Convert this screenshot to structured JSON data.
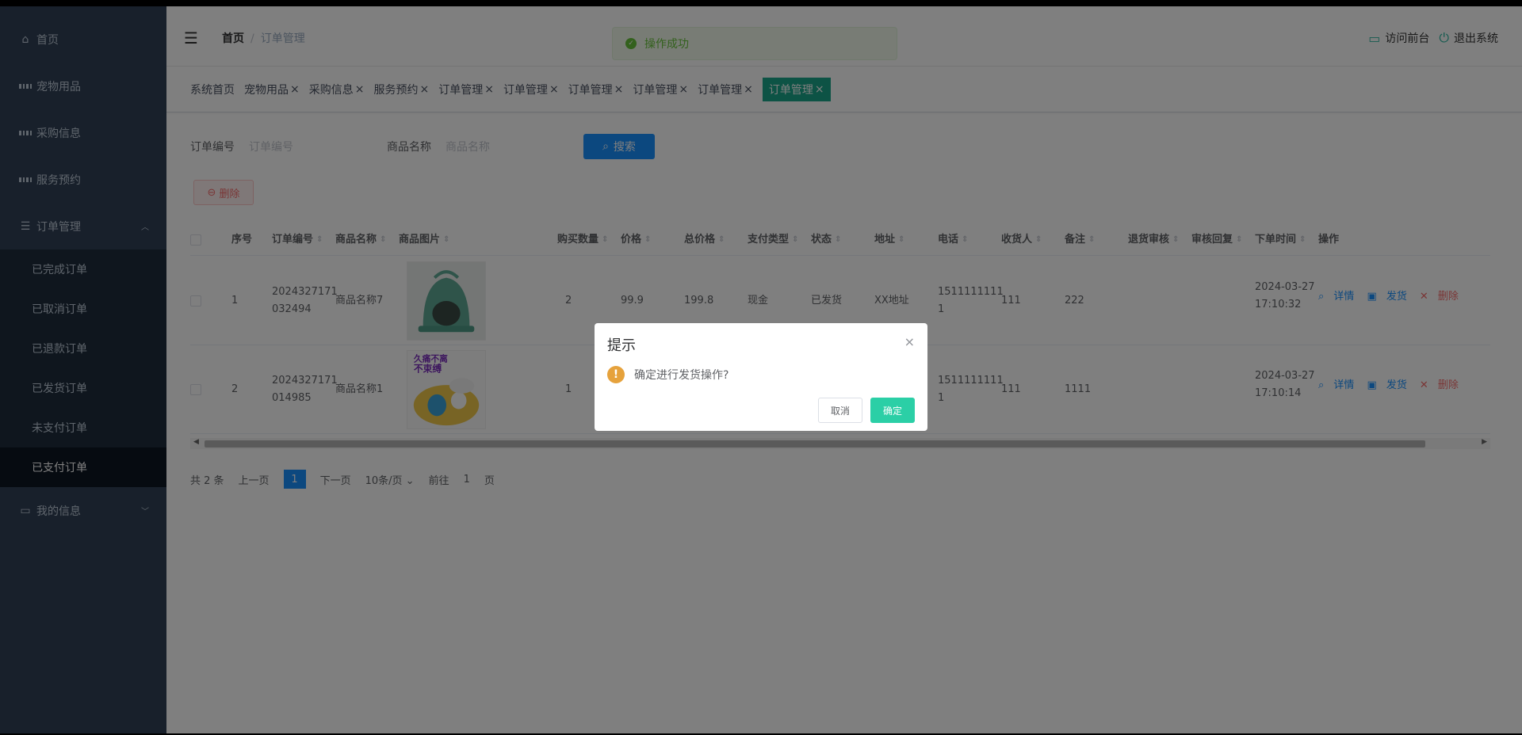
{
  "sidebar": {
    "items": [
      {
        "label": "首页",
        "icon": "home-icon"
      },
      {
        "label": "宠物用品",
        "icon": "grid-icon"
      },
      {
        "label": "采购信息",
        "icon": "grid-icon"
      },
      {
        "label": "服务预约",
        "icon": "grid-icon"
      },
      {
        "label": "订单管理",
        "icon": "list-icon"
      }
    ],
    "order_sub": [
      "已完成订单",
      "已取消订单",
      "已退款订单",
      "已发货订单",
      "未支付订单",
      "已支付订单"
    ],
    "my_info": "我的信息"
  },
  "header": {
    "breadcrumb_home": "首页",
    "breadcrumb_sep": "/",
    "breadcrumb_current": "订单管理",
    "toast": "操作成功",
    "visit_front": "访问前台",
    "logout": "退出系统"
  },
  "tags": [
    {
      "label": "系统首页",
      "closable": false
    },
    {
      "label": "宠物用品",
      "closable": true
    },
    {
      "label": "采购信息",
      "closable": true
    },
    {
      "label": "服务预约",
      "closable": true
    },
    {
      "label": "订单管理",
      "closable": true
    },
    {
      "label": "订单管理",
      "closable": true
    },
    {
      "label": "订单管理",
      "closable": true
    },
    {
      "label": "订单管理",
      "closable": true
    },
    {
      "label": "订单管理",
      "closable": true
    },
    {
      "label": "订单管理",
      "closable": true,
      "active": true
    }
  ],
  "tag_close": "×",
  "search": {
    "order_no_label": "订单编号",
    "order_no_placeholder": "订单编号",
    "product_label": "商品名称",
    "product_placeholder": "商品名称",
    "search_button": "搜索",
    "delete_button": "删除"
  },
  "table": {
    "headers": [
      "序号",
      "订单编号",
      "商品名称",
      "商品图片",
      "购买数量",
      "价格",
      "总价格",
      "支付类型",
      "状态",
      "地址",
      "电话",
      "收货人",
      "备注",
      "退货审核",
      "审核回复",
      "下单时间",
      "操作"
    ],
    "rows": [
      {
        "index": "1",
        "order_no_1": "2024327171",
        "order_no_2": "032494",
        "product": "商品名称7",
        "qty": "2",
        "price": "99.9",
        "total": "199.8",
        "pay_type": "现金",
        "status": "已发货",
        "address": "XX地址",
        "phone_1": "1511111111",
        "phone_2": "1",
        "receiver": "111",
        "remark": "222",
        "time_1": "2024-03-27",
        "time_2": "17:10:32"
      },
      {
        "index": "2",
        "order_no_1": "2024327171",
        "order_no_2": "014985",
        "product": "商品名称1",
        "qty": "1",
        "price": "",
        "total": "",
        "pay_type": "",
        "status": "",
        "address": "",
        "phone_1": "1511111111",
        "phone_2": "1",
        "receiver": "111",
        "remark": "1111",
        "time_1": "2024-03-27",
        "time_2": "17:10:14",
        "thumb_text_1": "久痛不离",
        "thumb_text_2": "不束缚"
      }
    ],
    "ops": {
      "detail": "详情",
      "ship": "发货",
      "delete": "删除"
    }
  },
  "pager": {
    "total": "共 2 条",
    "prev": "上一页",
    "page": "1",
    "next": "下一页",
    "size": "10条/页",
    "goto": "前往",
    "goto_page": "1",
    "page_unit": "页"
  },
  "dialog": {
    "title": "提示",
    "message": "确定进行发货操作?",
    "cancel": "取消",
    "confirm": "确定",
    "close": "×"
  },
  "colors": {
    "sidebar": "#304156",
    "accent": "#1aa68a",
    "primary": "#1890ff",
    "confirm": "#2bcfa6",
    "warning": "#e6a23c"
  }
}
